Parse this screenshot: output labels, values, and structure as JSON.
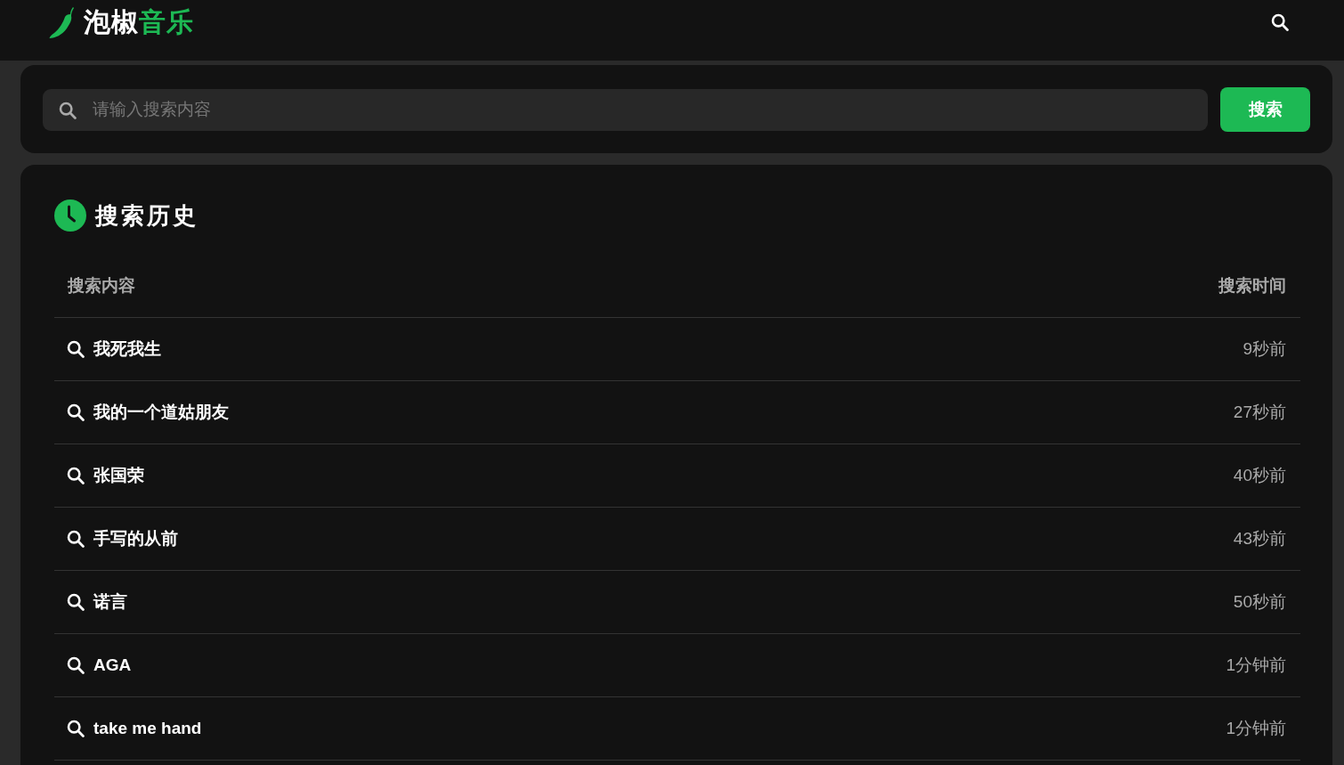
{
  "header": {
    "logo": {
      "primary": "泡椒",
      "accent": "音乐"
    }
  },
  "search": {
    "placeholder": "请输入搜索内容",
    "button": "搜索"
  },
  "history": {
    "title": "搜索历史",
    "columns": [
      "搜索内容",
      "搜索时间"
    ],
    "rows": [
      {
        "query": "我死我生",
        "time": "9秒前"
      },
      {
        "query": "我的一个道姑朋友",
        "time": "27秒前"
      },
      {
        "query": "张国荣",
        "time": "40秒前"
      },
      {
        "query": "手写的从前",
        "time": "43秒前"
      },
      {
        "query": "诺言",
        "time": "50秒前"
      },
      {
        "query": "AGA",
        "time": "1分钟前"
      },
      {
        "query": "take me hand",
        "time": "1分钟前"
      }
    ]
  }
}
